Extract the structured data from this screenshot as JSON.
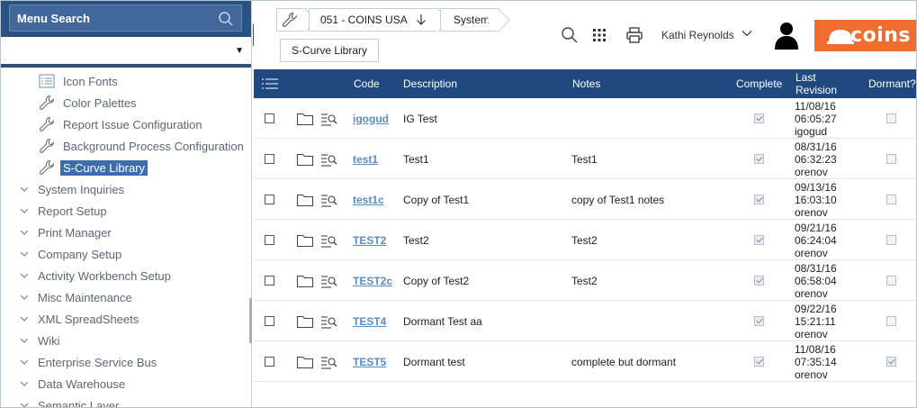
{
  "sidebar": {
    "title": "Menu Search",
    "select_value": "",
    "tree": [
      {
        "label": "Icon Fonts",
        "icon": "list-icon",
        "kind": "leaf"
      },
      {
        "label": "Color Palettes",
        "icon": "wrench-icon",
        "kind": "leaf"
      },
      {
        "label": "Report Issue Configuration",
        "icon": "wrench-icon",
        "kind": "leaf"
      },
      {
        "label": "Background Process Configuration",
        "icon": "wrench-icon",
        "kind": "leaf"
      },
      {
        "label": "S-Curve Library",
        "icon": "wrench-icon",
        "kind": "leaf",
        "selected": true
      },
      {
        "label": "System Inquiries",
        "kind": "group"
      },
      {
        "label": "Report Setup",
        "kind": "group"
      },
      {
        "label": "Print Manager",
        "kind": "group"
      },
      {
        "label": "Company Setup",
        "kind": "group"
      },
      {
        "label": "Activity Workbench Setup",
        "kind": "group"
      },
      {
        "label": "Misc Maintenance",
        "kind": "group"
      },
      {
        "label": "XML SpreadSheets",
        "kind": "group"
      },
      {
        "label": "Wiki",
        "kind": "group"
      },
      {
        "label": "Enterprise Service Bus",
        "kind": "group"
      },
      {
        "label": "Data Warehouse",
        "kind": "group"
      },
      {
        "label": "Semantic Layer",
        "kind": "group"
      }
    ]
  },
  "breadcrumb": {
    "company": "051 - COINS USA",
    "module": "System",
    "page": "S-Curve Library"
  },
  "header": {
    "user_name": "Kathi Reynolds",
    "logo_text": "coins",
    "brand_color": "#ef6e2d",
    "header_color": "#20497f"
  },
  "table": {
    "columns": {
      "code": "Code",
      "description": "Description",
      "notes": "Notes",
      "complete": "Complete",
      "last_revision_1": "Last",
      "last_revision_2": "Revision",
      "dormant": "Dormant?"
    },
    "rows": [
      {
        "code": "igogud",
        "description": "IG Test",
        "notes": "",
        "complete": true,
        "rev_date": "11/08/16",
        "rev_time": "06:05:27",
        "rev_user": "igogud",
        "dormant": false
      },
      {
        "code": "test1",
        "description": "Test1",
        "notes": "Test1",
        "complete": true,
        "rev_date": "08/31/16",
        "rev_time": "06:32:23",
        "rev_user": "orenov",
        "dormant": false
      },
      {
        "code": "test1c",
        "description": "Copy of Test1",
        "notes": "copy of Test1 notes",
        "complete": true,
        "rev_date": "09/13/16",
        "rev_time": "16:03:10",
        "rev_user": "orenov",
        "dormant": false
      },
      {
        "code": "TEST2",
        "description": "Test2",
        "notes": "Test2",
        "complete": true,
        "rev_date": "09/21/16",
        "rev_time": "06:24:04",
        "rev_user": "orenov",
        "dormant": false
      },
      {
        "code": "TEST2c",
        "description": "Copy of Test2",
        "notes": "Test2",
        "complete": true,
        "rev_date": "08/31/16",
        "rev_time": "06:58:04",
        "rev_user": "orenov",
        "dormant": false
      },
      {
        "code": "TEST4",
        "description": "Dormant Test aa",
        "notes": "",
        "complete": true,
        "rev_date": "09/22/16",
        "rev_time": "15:21:11",
        "rev_user": "orenov",
        "dormant": false
      },
      {
        "code": "TEST5",
        "description": "Dormant test",
        "notes": "complete but dormant",
        "complete": true,
        "rev_date": "11/08/16",
        "rev_time": "07:35:14",
        "rev_user": "orenov",
        "dormant": true
      }
    ]
  }
}
